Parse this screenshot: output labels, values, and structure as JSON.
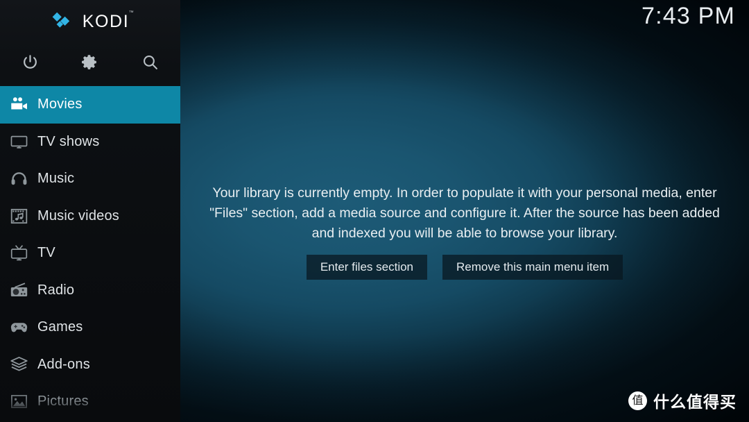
{
  "app": {
    "name": "KODI",
    "trademark": "™",
    "logo_color": "#32b4e5",
    "accent_color": "#0e87a6",
    "sidebar_color": "#0d1013",
    "background_color": "#154a63",
    "clock": "7:43 PM"
  },
  "toolbar": {
    "buttons": [
      {
        "name": "power-icon",
        "label": "Power"
      },
      {
        "name": "gear-icon",
        "label": "Settings"
      },
      {
        "name": "search-icon",
        "label": "Search"
      }
    ]
  },
  "sidebar": {
    "items": [
      {
        "label": "Movies",
        "icon": "movie-camera-icon",
        "active": true,
        "dim": false
      },
      {
        "label": "TV shows",
        "icon": "tv-monitor-icon",
        "active": false,
        "dim": false
      },
      {
        "label": "Music",
        "icon": "headphones-icon",
        "active": false,
        "dim": false
      },
      {
        "label": "Music videos",
        "icon": "film-music-icon",
        "active": false,
        "dim": false
      },
      {
        "label": "TV",
        "icon": "retro-tv-icon",
        "active": false,
        "dim": false
      },
      {
        "label": "Radio",
        "icon": "radio-icon",
        "active": false,
        "dim": false
      },
      {
        "label": "Games",
        "icon": "gamepad-icon",
        "active": false,
        "dim": false
      },
      {
        "label": "Add-ons",
        "icon": "addons-box-icon",
        "active": false,
        "dim": false
      },
      {
        "label": "Pictures",
        "icon": "picture-icon",
        "active": false,
        "dim": true
      }
    ]
  },
  "main": {
    "empty_message": "Your library is currently empty. In order to populate it with your personal media, enter \"Files\" section, add a media source and configure it. After the source has been added and indexed you will be able to browse your library.",
    "buttons": {
      "enter_files": "Enter files section",
      "remove_item": "Remove this main menu item"
    }
  },
  "watermark": {
    "badge": "值",
    "text": "什么值得买"
  }
}
